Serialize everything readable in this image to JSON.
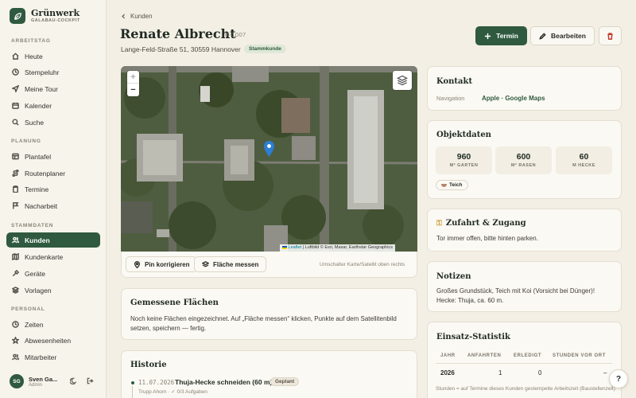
{
  "brand": {
    "name": "Grünwerk",
    "subtitle": "GALABAU-COCKPIT"
  },
  "sidebar": {
    "sections": [
      {
        "label": "ARBEITSTAG",
        "items": [
          {
            "label": "Heute",
            "icon": "home-icon"
          },
          {
            "label": "Stempeluhr",
            "icon": "clock-icon"
          },
          {
            "label": "Meine Tour",
            "icon": "send-icon"
          },
          {
            "label": "Kalender",
            "icon": "calendar-icon"
          },
          {
            "label": "Suche",
            "icon": "search-icon"
          }
        ]
      },
      {
        "label": "PLANUNG",
        "items": [
          {
            "label": "Plantafel",
            "icon": "board-icon"
          },
          {
            "label": "Routenplaner",
            "icon": "route-icon"
          },
          {
            "label": "Termine",
            "icon": "clipboard-icon"
          },
          {
            "label": "Nacharbeit",
            "icon": "flag-icon"
          }
        ]
      },
      {
        "label": "STAMMDATEN",
        "items": [
          {
            "label": "Kunden",
            "icon": "users-icon",
            "active": true
          },
          {
            "label": "Kundenkarte",
            "icon": "map-icon"
          },
          {
            "label": "Geräte",
            "icon": "hammer-icon"
          },
          {
            "label": "Vorlagen",
            "icon": "layers-icon"
          }
        ]
      },
      {
        "label": "PERSONAL",
        "items": [
          {
            "label": "Zeiten",
            "icon": "clock-icon"
          },
          {
            "label": "Abwesenheiten",
            "icon": "star-icon"
          },
          {
            "label": "Mitarbeiter",
            "icon": "users-icon"
          }
        ]
      }
    ]
  },
  "user": {
    "initials": "SG",
    "name": "Sven Ga...",
    "role": "Admin"
  },
  "header": {
    "back_label": "Kunden",
    "title": "Renate Albrecht",
    "customer_id": "K-1007",
    "address": "Lange-Feld-Straße 51, 30559 Hannover",
    "badge": "Stammkunde",
    "termin_label": "Termin",
    "edit_label": "Bearbeiten"
  },
  "map": {
    "zoom_in": "+",
    "zoom_out": "−",
    "attribution_leaflet": "Leaflet",
    "attribution_rest": " | Luftbild © Esri, Maxar, Earthstar Geographics",
    "pin_button": "Pin korrigieren",
    "area_button": "Fläche messen",
    "hint": "Umschalter Karte/Satellit oben rechts"
  },
  "areas": {
    "title": "Gemessene Flächen",
    "text": "Noch keine Flächen eingezeichnet. Auf „Fläche messen“ klicken, Punkte auf dem Satellitenbild setzen, speichern — fertig."
  },
  "history": {
    "title": "Historie",
    "entries": [
      {
        "date": "11.07.2026",
        "title": "Thuja-Hecke schneiden (60 m)",
        "status": "Geplant",
        "sub": "Trupp Ahorn · ✓ 0/3 Aufgaben"
      }
    ]
  },
  "contact": {
    "title": "Kontakt",
    "nav_label": "Navigation",
    "nav_value": "Apple · Google Maps"
  },
  "object": {
    "title": "Objektdaten",
    "stats": [
      {
        "value": "960",
        "label": "M² GARTEN"
      },
      {
        "value": "600",
        "label": "M² RASEN"
      },
      {
        "value": "60",
        "label": "M HECKE"
      }
    ],
    "tag": "Teich"
  },
  "access": {
    "title": "Zufahrt & Zugang",
    "text": "Tor immer offen, bitte hinten parken."
  },
  "notes": {
    "title": "Notizen",
    "text": "Großes Grundstück, Teich mit Koi (Vorsicht bei Dünger)! Hecke: Thuja, ca. 60 m."
  },
  "stats": {
    "title": "Einsatz-Statistik",
    "headers": [
      "JAHR",
      "ANFAHRTEN",
      "ERLEDIGT",
      "STUNDEN VOR ORT"
    ],
    "row": [
      "2026",
      "1",
      "0",
      "–"
    ],
    "footnote": "Stunden = auf Termine dieses Kunden gestempelte Arbeitszeit (Baustellenzeit)"
  },
  "help_label": "?",
  "colors": {
    "accent": "#2f5a3f",
    "background": "#f3efe5",
    "card": "#fbf9f4",
    "danger": "#c0392b"
  }
}
